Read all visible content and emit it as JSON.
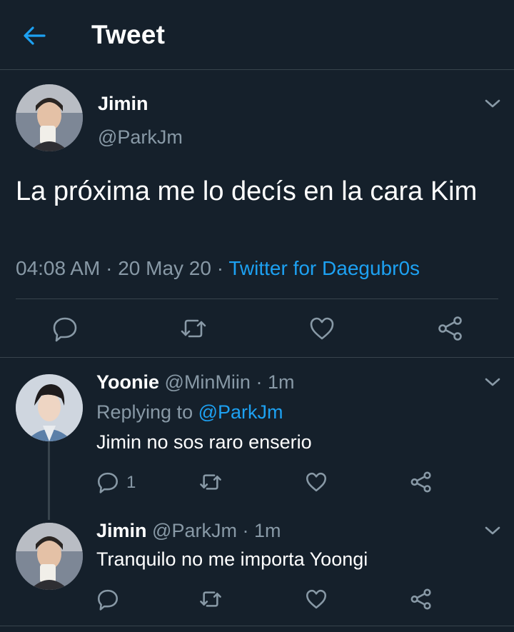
{
  "header": {
    "title": "Tweet"
  },
  "main_tweet": {
    "name": "Jimin",
    "handle": "@ParkJm",
    "text": "La próxima me lo decís en la cara Kim",
    "time": "04:08 AM",
    "separator": "·",
    "date": "20 May 20",
    "source": "Twitter for Daegubr0s"
  },
  "replies": [
    {
      "name": "Yoonie",
      "handle": "@MinMiin",
      "dot": "·",
      "age": "1m",
      "replying_prefix": "Replying to",
      "replying_handle": "@ParkJm",
      "text": "Jimin no sos raro enserio",
      "reply_count": "1"
    },
    {
      "name": "Jimin",
      "handle": "@ParkJm",
      "dot": "·",
      "age": "1m",
      "text": "Tranquilo no me importa Yoongi"
    }
  ],
  "icons": {
    "back": "arrow-left-icon",
    "more": "chevron-down-icon",
    "reply": "comment-icon",
    "retweet": "retweet-icon",
    "like": "heart-icon",
    "share": "share-icon"
  },
  "colors": {
    "background": "#15202b",
    "accent": "#1da1f2",
    "secondary_text": "#8899a6",
    "divider": "#38444d"
  }
}
